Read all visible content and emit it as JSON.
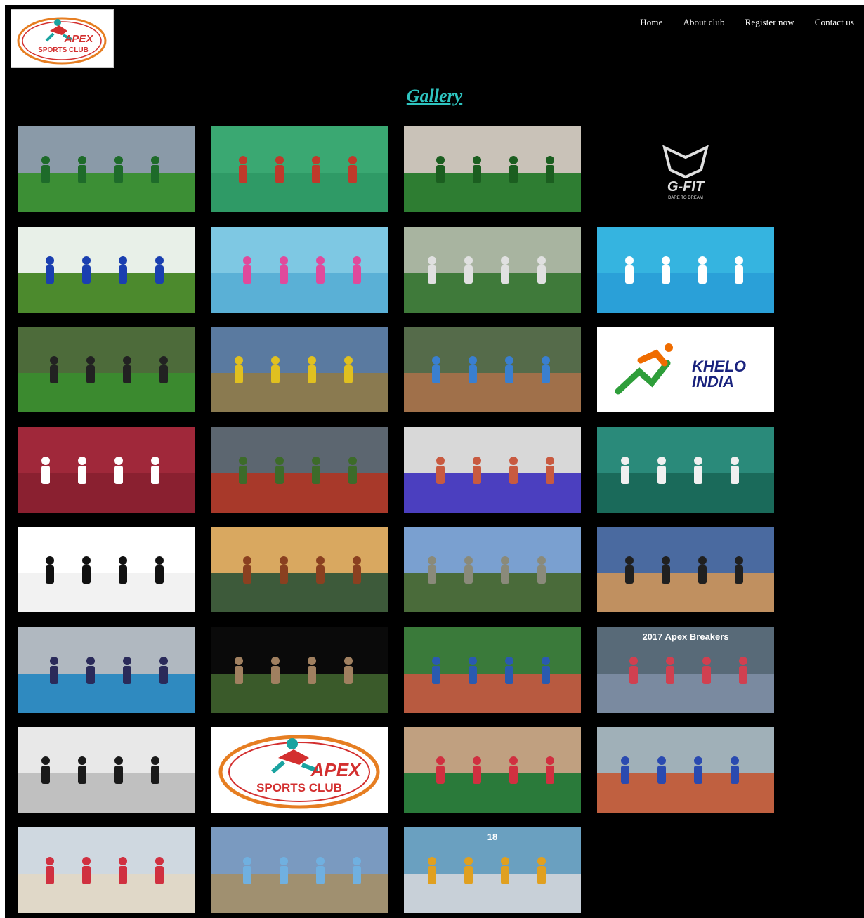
{
  "brand": {
    "logo_text_line1": "APEX",
    "logo_text_line2": "SPORTS CLUB",
    "colors": {
      "red": "#d32f2f",
      "orange": "#e67e22",
      "teal": "#1aa3a0"
    }
  },
  "nav": {
    "items": [
      {
        "label": "Home"
      },
      {
        "label": "About club"
      },
      {
        "label": "Register now"
      },
      {
        "label": "Contact us"
      }
    ]
  },
  "page": {
    "title": "Gallery",
    "title_color": "#2ec4c0"
  },
  "gallery": {
    "tiles": [
      {
        "kind": "photo",
        "name": "football-match-photo",
        "sky": "#8a9aa8",
        "ground": "#3c8f35",
        "accent": "#1e6b2a"
      },
      {
        "kind": "photo",
        "name": "indoor-court-photo",
        "sky": "#3aa872",
        "ground": "#2f9a66",
        "accent": "#c0392b"
      },
      {
        "kind": "photo",
        "name": "football-team-celebration-photo",
        "sky": "#c9c2b8",
        "ground": "#2e7d32",
        "accent": "#1b5e20"
      },
      {
        "kind": "logo",
        "name": "g-fit-logo",
        "text": "G-FIT",
        "subtext": "DARE TO DREAM",
        "bg": "#000000",
        "fg": "#e0e0e0"
      },
      {
        "kind": "photo",
        "name": "football-closeup-photo",
        "sky": "#e8f0e8",
        "ground": "#4c8a2d",
        "accent": "#1a3fb0"
      },
      {
        "kind": "photo",
        "name": "swimmer-cap-photo",
        "sky": "#7ec8e3",
        "ground": "#5ab0d6",
        "accent": "#e04a9c"
      },
      {
        "kind": "photo",
        "name": "indoor-yoga-photo",
        "sky": "#a8b4a0",
        "ground": "#3f7a3a",
        "accent": "#e0e0e0"
      },
      {
        "kind": "photo",
        "name": "swimming-pool-photo",
        "sky": "#35b4e0",
        "ground": "#2aa0d8",
        "accent": "#ffffff"
      },
      {
        "kind": "photo",
        "name": "football-running-photo",
        "sky": "#4d6b3a",
        "ground": "#3b8a2f",
        "accent": "#222222"
      },
      {
        "kind": "photo",
        "name": "team-group-photo",
        "sky": "#5a7aa0",
        "ground": "#8a7a50",
        "accent": "#e0c020"
      },
      {
        "kind": "photo",
        "name": "badminton-hall-photo",
        "sky": "#556b4a",
        "ground": "#a0704a",
        "accent": "#3a7fd0"
      },
      {
        "kind": "logo",
        "name": "khelo-india-logo",
        "text": "KHELO",
        "subtext": "INDIA",
        "bg": "#ffffff",
        "fg": "#1a237e"
      },
      {
        "kind": "photo",
        "name": "award-ceremony-photo",
        "sky": "#a0283a",
        "ground": "#8a2030",
        "accent": "#ffffff"
      },
      {
        "kind": "photo",
        "name": "running-track-photo",
        "sky": "#5c6670",
        "ground": "#a8392a",
        "accent": "#3d6b2a"
      },
      {
        "kind": "photo",
        "name": "volleyball-court-photo",
        "sky": "#d8d8d8",
        "ground": "#4b3fbf",
        "accent": "#c85a40"
      },
      {
        "kind": "photo",
        "name": "apex-badminton-photo",
        "sky": "#2a8a7a",
        "ground": "#1a6a5a",
        "accent": "#f0f0f0"
      },
      {
        "kind": "photo",
        "name": "volleyball-spike-photo",
        "sky": "#ffffff",
        "ground": "#f2f2f2",
        "accent": "#111111"
      },
      {
        "kind": "photo",
        "name": "campus-aerial-photo",
        "sky": "#d9a860",
        "ground": "#3d5a3a",
        "accent": "#8a4020"
      },
      {
        "kind": "photo",
        "name": "stadium-landscape-photo",
        "sky": "#7aa0d0",
        "ground": "#4a6b3a",
        "accent": "#8a8a7a"
      },
      {
        "kind": "photo",
        "name": "badminton-players-photo",
        "sky": "#4a6aa0",
        "ground": "#c09060",
        "accent": "#202020"
      },
      {
        "kind": "photo",
        "name": "apex-jersey-pool-photo",
        "sky": "#b0b8c0",
        "ground": "#2f8ac0",
        "accent": "#2a2a5a"
      },
      {
        "kind": "photo",
        "name": "statue-photo",
        "sky": "#0a0a0a",
        "ground": "#3a5a2a",
        "accent": "#a08060"
      },
      {
        "kind": "photo",
        "name": "sprint-race-photo",
        "sky": "#3a7a3a",
        "ground": "#b85a40",
        "accent": "#2a5ab0"
      },
      {
        "kind": "photo",
        "name": "apex-breakers-group-photo",
        "sky": "#586a78",
        "ground": "#7a8aa0",
        "accent": "#d04050",
        "caption": "2017 Apex Breakers"
      },
      {
        "kind": "photo",
        "name": "runner-sketch-photo",
        "sky": "#e8e8e8",
        "ground": "#c0c0c0",
        "accent": "#1a1a1a"
      },
      {
        "kind": "apexlogo",
        "name": "apex-sports-club-logo"
      },
      {
        "kind": "photo",
        "name": "shot-put-photo",
        "sky": "#c0a080",
        "ground": "#2a7a3a",
        "accent": "#d03040"
      },
      {
        "kind": "photo",
        "name": "outdoor-court-photo",
        "sky": "#a0b0b8",
        "ground": "#c06040",
        "accent": "#2a4ab0"
      },
      {
        "kind": "photo",
        "name": "volleyball-jump-photo",
        "sky": "#cfd8e0",
        "ground": "#e0d8c8",
        "accent": "#d03040"
      },
      {
        "kind": "photo",
        "name": "team-trophy-photo",
        "sky": "#7a9ac0",
        "ground": "#a09070",
        "accent": "#70b0e0"
      },
      {
        "kind": "photo",
        "name": "volleyball-block-photo",
        "sky": "#6aa0c0",
        "ground": "#c8d0d8",
        "accent": "#e0a020",
        "caption": "18"
      }
    ]
  }
}
